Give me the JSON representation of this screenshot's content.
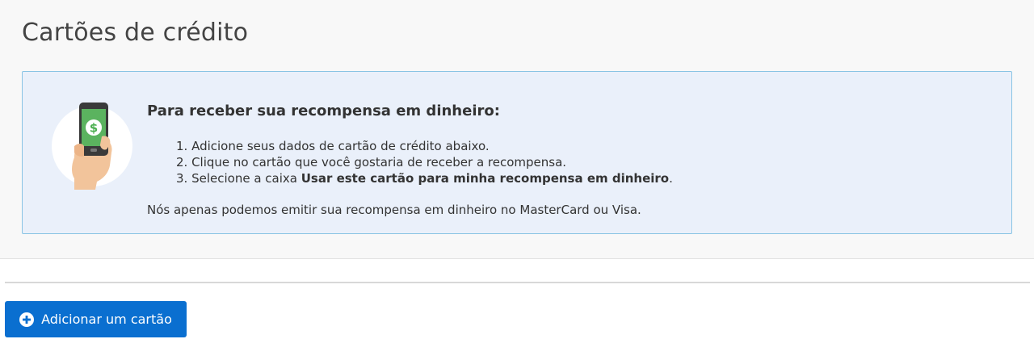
{
  "page": {
    "title": "Cartões de crédito"
  },
  "info": {
    "heading": "Para receber sua recompensa em dinheiro:",
    "steps": [
      {
        "text": "1. Adicione seus dados de cartão de crédito abaixo."
      },
      {
        "text": "2. Clique no cartão que você gostaria de receber a recompensa."
      },
      {
        "prefix": "3. Selecione a caixa ",
        "bold": "Usar este cartão para minha recompensa em dinheiro",
        "suffix": "."
      }
    ],
    "note": "Nós apenas podemos emitir sua recompensa em dinheiro no MasterCard ou Visa.",
    "illustration_icon": "phone-dollar-hand-icon"
  },
  "actions": {
    "add_card_label": "Adicionar um cartão",
    "add_card_icon": "plus-circle-icon"
  },
  "colors": {
    "accent": "#0a6fd0",
    "info_bg": "#eaf0fa",
    "info_border": "#89c4e4",
    "money_green": "#4caf50"
  }
}
